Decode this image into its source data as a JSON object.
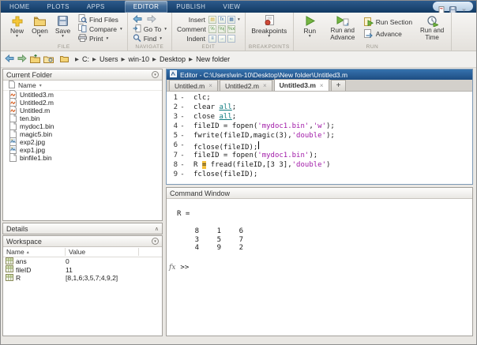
{
  "ribbon": {
    "tabs": [
      {
        "label": "HOME"
      },
      {
        "label": "PLOTS"
      },
      {
        "label": "APPS"
      },
      {
        "label": "EDITOR",
        "active": true,
        "gap": true
      },
      {
        "label": "PUBLISH"
      },
      {
        "label": "VIEW"
      }
    ],
    "file": {
      "label": "FILE",
      "new": "New",
      "open": "Open",
      "save": "Save",
      "find_files": "Find Files",
      "compare": "Compare",
      "print": "Print"
    },
    "navigate": {
      "label": "NAVIGATE",
      "goto": "Go To",
      "find": "Find"
    },
    "edit": {
      "label": "EDIT",
      "insert": "Insert",
      "comment": "Comment",
      "indent": "Indent"
    },
    "breakpoints": {
      "label": "BREAKPOINTS",
      "button": "Breakpoints"
    },
    "run": {
      "label": "RUN",
      "run": "Run",
      "run_and_advance": "Run and Advance",
      "run_section": "Run Section",
      "advance": "Advance",
      "run_and_time": "Run and Time"
    }
  },
  "address_bar": {
    "segments": [
      "C:",
      "Users",
      "win-10",
      "Desktop",
      "New folder"
    ]
  },
  "current_folder": {
    "title": "Current Folder",
    "column": "Name",
    "files": [
      {
        "name": "Untitled3.m",
        "type": "m"
      },
      {
        "name": "Untitled2.m",
        "type": "m"
      },
      {
        "name": "Untitled.m",
        "type": "m"
      },
      {
        "name": "ten.bin",
        "type": "bin"
      },
      {
        "name": "mydoc1.bin",
        "type": "bin"
      },
      {
        "name": "magic5.bin",
        "type": "bin"
      },
      {
        "name": "exp2.jpg",
        "type": "jpg"
      },
      {
        "name": "exp1.jpg",
        "type": "jpg"
      },
      {
        "name": "binfile1.bin",
        "type": "bin"
      }
    ]
  },
  "details": {
    "title": "Details"
  },
  "workspace": {
    "title": "Workspace",
    "columns": [
      "Name",
      "Value"
    ],
    "rows": [
      {
        "name": "ans",
        "value": "0"
      },
      {
        "name": "fileID",
        "value": "11"
      },
      {
        "name": "R",
        "value": "[8,1,6;3,5,7;4,9,2]"
      }
    ]
  },
  "editor": {
    "title": "Editor - C:\\Users\\win-10\\Desktop\\New folder\\Untitled3.m",
    "tabs": [
      {
        "label": "Untitled.m"
      },
      {
        "label": "Untitled2.m"
      },
      {
        "label": "Untitled3.m",
        "active": true
      }
    ],
    "new_tab_label": "+",
    "lines": [
      {
        "n": "1",
        "segs": [
          [
            "clc;",
            "def"
          ]
        ]
      },
      {
        "n": "2",
        "segs": [
          [
            "clear ",
            "def"
          ],
          [
            "all",
            "link"
          ],
          [
            ";",
            "def"
          ]
        ]
      },
      {
        "n": "3",
        "segs": [
          [
            "close ",
            "def"
          ],
          [
            "all",
            "link"
          ],
          [
            ";",
            "def"
          ]
        ]
      },
      {
        "n": "4",
        "segs": [
          [
            "fileID = fopen(",
            "def"
          ],
          [
            "'mydoc1.bin'",
            "str"
          ],
          [
            ",",
            "def"
          ],
          [
            "'w'",
            "str"
          ],
          [
            ");",
            "def"
          ]
        ]
      },
      {
        "n": "5",
        "segs": [
          [
            "fwrite(fileID,magic(3),",
            "def"
          ],
          [
            "'double'",
            "str"
          ],
          [
            ");",
            "def"
          ]
        ]
      },
      {
        "n": "6",
        "segs": [
          [
            "fclose(fileID);",
            "def"
          ],
          [
            "",
            "cursor"
          ]
        ]
      },
      {
        "n": "7",
        "segs": [
          [
            "fileID = fopen(",
            "def"
          ],
          [
            "'mydoc1.bin'",
            "str"
          ],
          [
            ");",
            "def"
          ]
        ]
      },
      {
        "n": "8",
        "segs": [
          [
            "R ",
            "def"
          ],
          [
            "=",
            "warn"
          ],
          [
            " fread(fileID,[3 3],",
            "def"
          ],
          [
            "'double'",
            "str"
          ],
          [
            ")",
            "def"
          ]
        ]
      },
      {
        "n": "9",
        "segs": [
          [
            "fclose(fileID);",
            "def"
          ]
        ]
      }
    ]
  },
  "command_window": {
    "title": "Command Window",
    "result_label": "R =",
    "matrix": [
      [
        "8",
        "1",
        "6"
      ],
      [
        "3",
        "5",
        "7"
      ],
      [
        "4",
        "9",
        "2"
      ]
    ],
    "fx_label": "fx",
    "prompt": ">>"
  },
  "colors": {
    "titlebar_blue": "#1d4d82",
    "tabstrip_blue": "#123a63",
    "string_purple": "#a11aa8",
    "link_teal": "#0e7c80",
    "warning_highlight": "#f5c13d",
    "run_green": "#76b543",
    "accent_yellow": "#f5c638"
  }
}
